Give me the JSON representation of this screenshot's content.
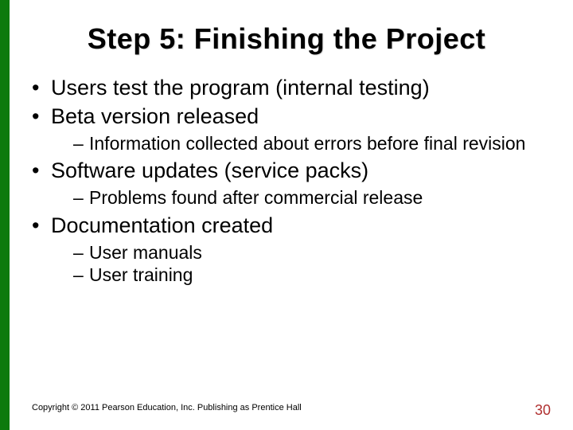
{
  "title": "Step 5: Finishing the Project",
  "bullets": {
    "b0": "Users test the program (internal testing)",
    "b1": "Beta version released",
    "b1s0": "Information collected about errors before final revision",
    "b2": "Software updates (service packs)",
    "b2s0": "Problems found after commercial release",
    "b3": "Documentation created",
    "b3s0": "User manuals",
    "b3s1": "User training"
  },
  "footer": "Copyright © 2011 Pearson Education, Inc. Publishing as Prentice Hall",
  "page_number": "30"
}
